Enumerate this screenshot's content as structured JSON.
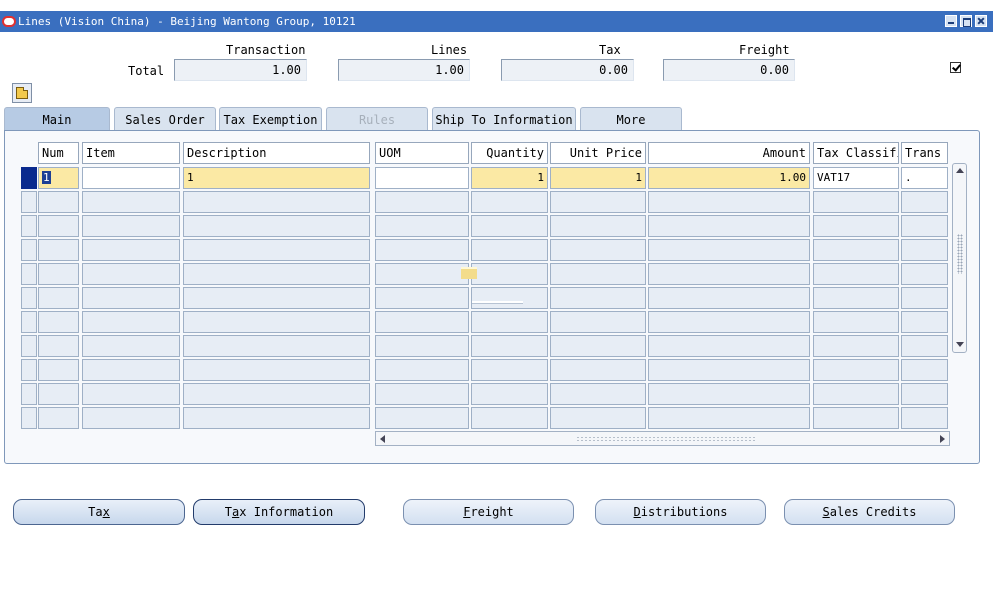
{
  "window": {
    "title": "Lines (Vision China) - Beijing Wantong Group, 10121"
  },
  "totals": {
    "row_label": "Total",
    "headers": [
      "Transaction",
      "Lines",
      "Tax",
      "Freight"
    ],
    "values": [
      "1.00",
      "1.00",
      "0.00",
      "0.00"
    ],
    "checkbox_checked": true
  },
  "tabs": [
    {
      "label": "Main",
      "state": "active"
    },
    {
      "label": "Sales Order",
      "state": "normal"
    },
    {
      "label": "Tax Exemption",
      "state": "normal"
    },
    {
      "label": "Rules",
      "state": "disabled"
    },
    {
      "label": "Ship To Information",
      "state": "normal"
    },
    {
      "label": "More",
      "state": "normal"
    }
  ],
  "table": {
    "columns": [
      "Num",
      "Item",
      "Description",
      "UOM",
      "Quantity",
      "Unit Price",
      "Amount",
      "Tax Classifi",
      "Trans"
    ],
    "first_row": [
      "1",
      "",
      "1",
      "",
      "1",
      "1",
      "1.00",
      "VAT17",
      "."
    ],
    "empty_rows": 10
  },
  "buttons": [
    {
      "label": "Tax",
      "mnemonic_index": 2
    },
    {
      "label": "Tax Information",
      "mnemonic_index": 1
    },
    {
      "label": "Freight",
      "mnemonic_index": 0
    },
    {
      "label": "Distributions",
      "mnemonic_index": 0
    },
    {
      "label": "Sales Credits",
      "mnemonic_index": 0
    }
  ],
  "colors": {
    "titlebar": "#3a6fbf",
    "current_row_indicator": "#0a2a8e",
    "required_field": "#fbe9a4"
  },
  "icons": [
    "oracle-logo-icon",
    "minimize-icon",
    "maximize-icon",
    "close-icon",
    "open-folder-icon"
  ]
}
